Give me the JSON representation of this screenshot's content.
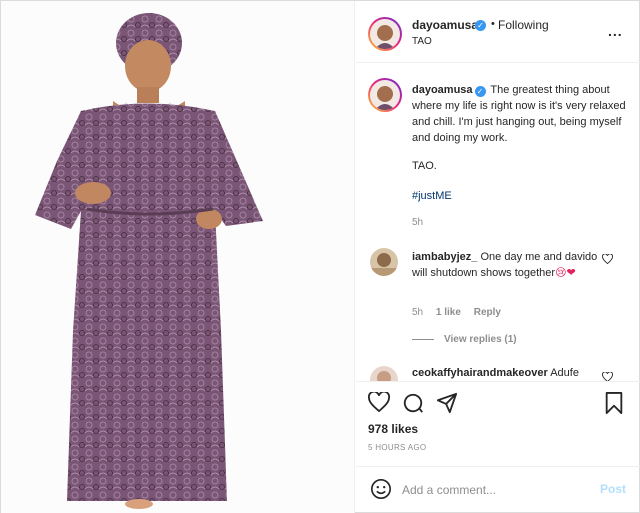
{
  "header": {
    "username": "dayoamusa",
    "dot": "•",
    "follow_status": "Following",
    "location": "TAO",
    "more": "..."
  },
  "caption": {
    "username": "dayoamusa",
    "text": "The greatest thing about where my life is right now is it's very relaxed and chill. I'm just hanging out, being myself and doing my work.",
    "signoff": "TAO.",
    "hashtag": "#justME",
    "time": "5h"
  },
  "comments": [
    {
      "username": "iambabyjez_",
      "text": "One day me and davido will shutdown shows together",
      "emoji": "😢❤",
      "time": "5h",
      "likes": "1 like",
      "reply": "Reply",
      "view_replies": "View replies (1)"
    },
    {
      "username": "ceokaffyhairandmakeover",
      "text": "Adufe"
    }
  ],
  "actions": {
    "likes": "978 likes",
    "timestamp": "5 HOURS AGO"
  },
  "add_comment": {
    "placeholder": "Add a comment...",
    "post_label": "Post"
  },
  "icons": {
    "verified": "verified-badge-icon",
    "heart": "heart-icon",
    "comment": "comment-icon",
    "share": "share-icon",
    "save": "bookmark-icon",
    "emoji": "emoji-icon"
  },
  "colors": {
    "verified": "#3897f0",
    "hashtag": "#00376b",
    "post_disabled": "#b2dffc",
    "dress": "#6e4e68"
  }
}
